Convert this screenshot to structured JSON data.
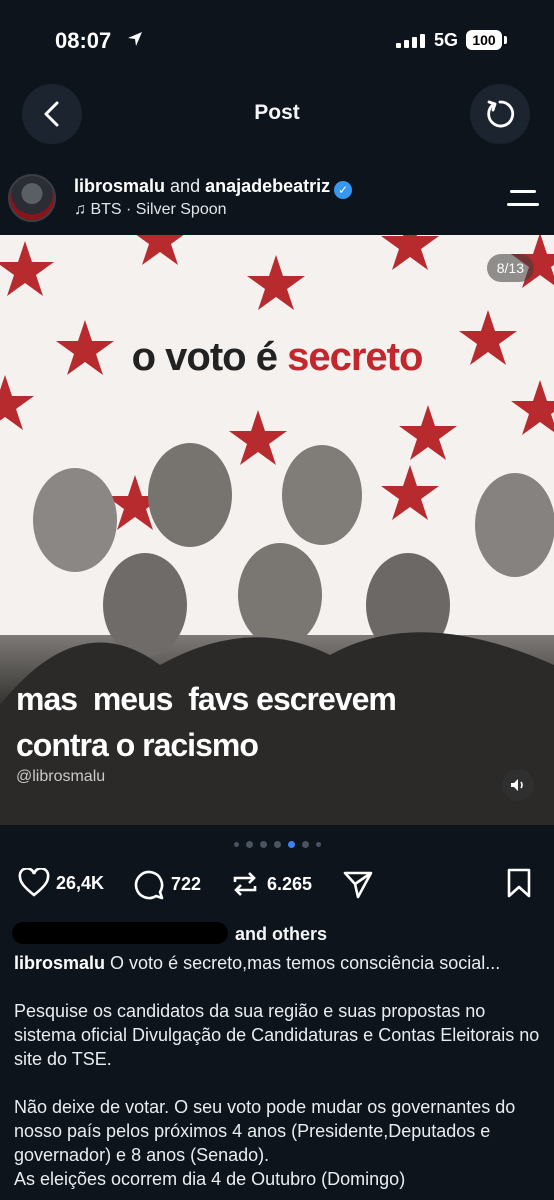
{
  "status_bar": {
    "time": "08:07",
    "network": "5G",
    "battery": "100"
  },
  "header": {
    "title": "Post"
  },
  "post": {
    "user": "librosmalu",
    "connector": "and",
    "coauthor": "anajadebeatriz",
    "music": "BTS · Silver Spoon",
    "image": {
      "counter": "8/13",
      "headline_part1": "o voto é",
      "headline_part2": "secreto",
      "overlay_line1": "mas  meus  favs escrevem",
      "overlay_line2": "contra o racismo",
      "watermark": "@librosmalu"
    },
    "carousel": {
      "total_dots": 7,
      "active_index": 4
    },
    "stats": {
      "likes": "26,4K",
      "comments": "722",
      "reposts": "6.265"
    },
    "liked_by_suffix": "and others",
    "caption": {
      "username": "librosmalu",
      "line1": "O voto é secreto,mas temos consciência social...",
      "p2": "Pesquise os candidatos da sua região e suas propostas no sistema oficial Divulgação de Candidaturas e Contas Eleitorais no site do TSE.",
      "p3": "Não deixe de votar. O seu voto pode mudar os governantes do nosso país pelos próximos 4 anos (Presidente,Deputados e governador) e 8 anos (Senado).",
      "p4": "As eleições ocorrem dia 4 de Outubro (Domingo)"
    }
  },
  "colors": {
    "background": "#0d141b",
    "accent_red": "#c1272d",
    "active_dot": "#3b82f6",
    "verified": "#3897f0"
  }
}
